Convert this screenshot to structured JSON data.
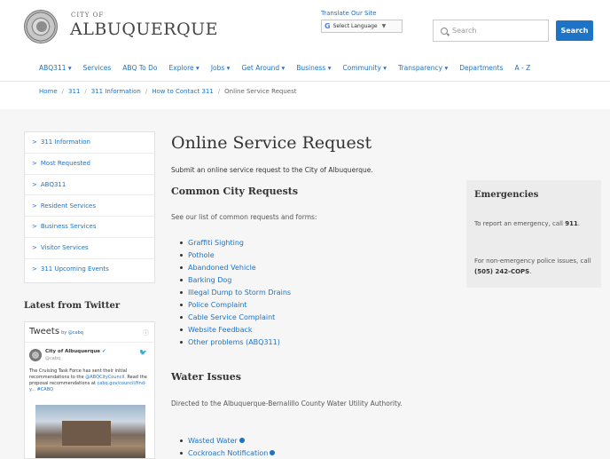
{
  "header": {
    "city_of": "CITY OF",
    "city_name": "ALBUQUERQUE",
    "translate_label": "Translate Our Site",
    "select_language": "Select Language",
    "google_g": "G",
    "lang_arrow": "▼",
    "search_placeholder": "Search",
    "search_button": "Search"
  },
  "nav": {
    "items": [
      "ABQ311 ▾",
      "Services",
      "ABQ To Do",
      "Explore ▾",
      "Jobs ▾",
      "Get Around ▾",
      "Business ▾",
      "Community ▾",
      "Transparency ▾",
      "Departments",
      "A - Z"
    ]
  },
  "breadcrumb": {
    "items": [
      "Home",
      "311",
      "311 Information",
      "How to Contact 311",
      "Online Service Request"
    ],
    "separator": "/"
  },
  "sidebar": {
    "arrow": ">",
    "items": [
      "311 Information",
      "Most Requested",
      "ABQ311",
      "Resident Services",
      "Business Services",
      "Visitor Services",
      "311 Upcoming Events"
    ]
  },
  "twitter": {
    "heading": "Latest from Twitter",
    "tweets_title": "Tweets",
    "by": "by @cabq",
    "info": "ⓘ",
    "account_name": "City of Albuquerque",
    "verified": "✔",
    "handle": "@cabq",
    "bird": "🐦",
    "text": "The Cruising Task Force has sent their initial recommendations to the",
    "text_link": "@ABQCityCouncil.",
    "text2": "Read the proposal recommendations at",
    "text_link2": "cabq.gov/council/find-y... #CABQ"
  },
  "main": {
    "title": "Online Service Request",
    "subtitle": "Submit an online service request to the City of Albuquerque.",
    "common_heading": "Common City Requests",
    "common_intro": "See our list of common requests and forms:",
    "common_items": [
      "Graffiti Sighting",
      "Pothole",
      "Abandoned Vehicle",
      "Barking Dog",
      "Illegal Dump to Storm Drains",
      "Police Complaint",
      "Cable Service Complaint",
      "Website Feedback",
      "Other problems (ABQ311)"
    ],
    "water_heading": "Water Issues",
    "water_intro": "Directed to the Albuquerque-Bernalillo County Water Utility Authority.",
    "water_items": [
      "Wasted Water",
      "Cockroach Notification"
    ]
  },
  "emergencies": {
    "title": "Emergencies",
    "line1": "To report an emergency, call",
    "line1_bold": "911",
    "line2": "For non-emergency police issues, call",
    "line2_bold": "(505) 242-COPS"
  },
  "colors": {
    "link": "#1d73c6",
    "search_button": "#1d73c6",
    "band": "#f6f6f6",
    "emergency_box": "#ececec"
  }
}
